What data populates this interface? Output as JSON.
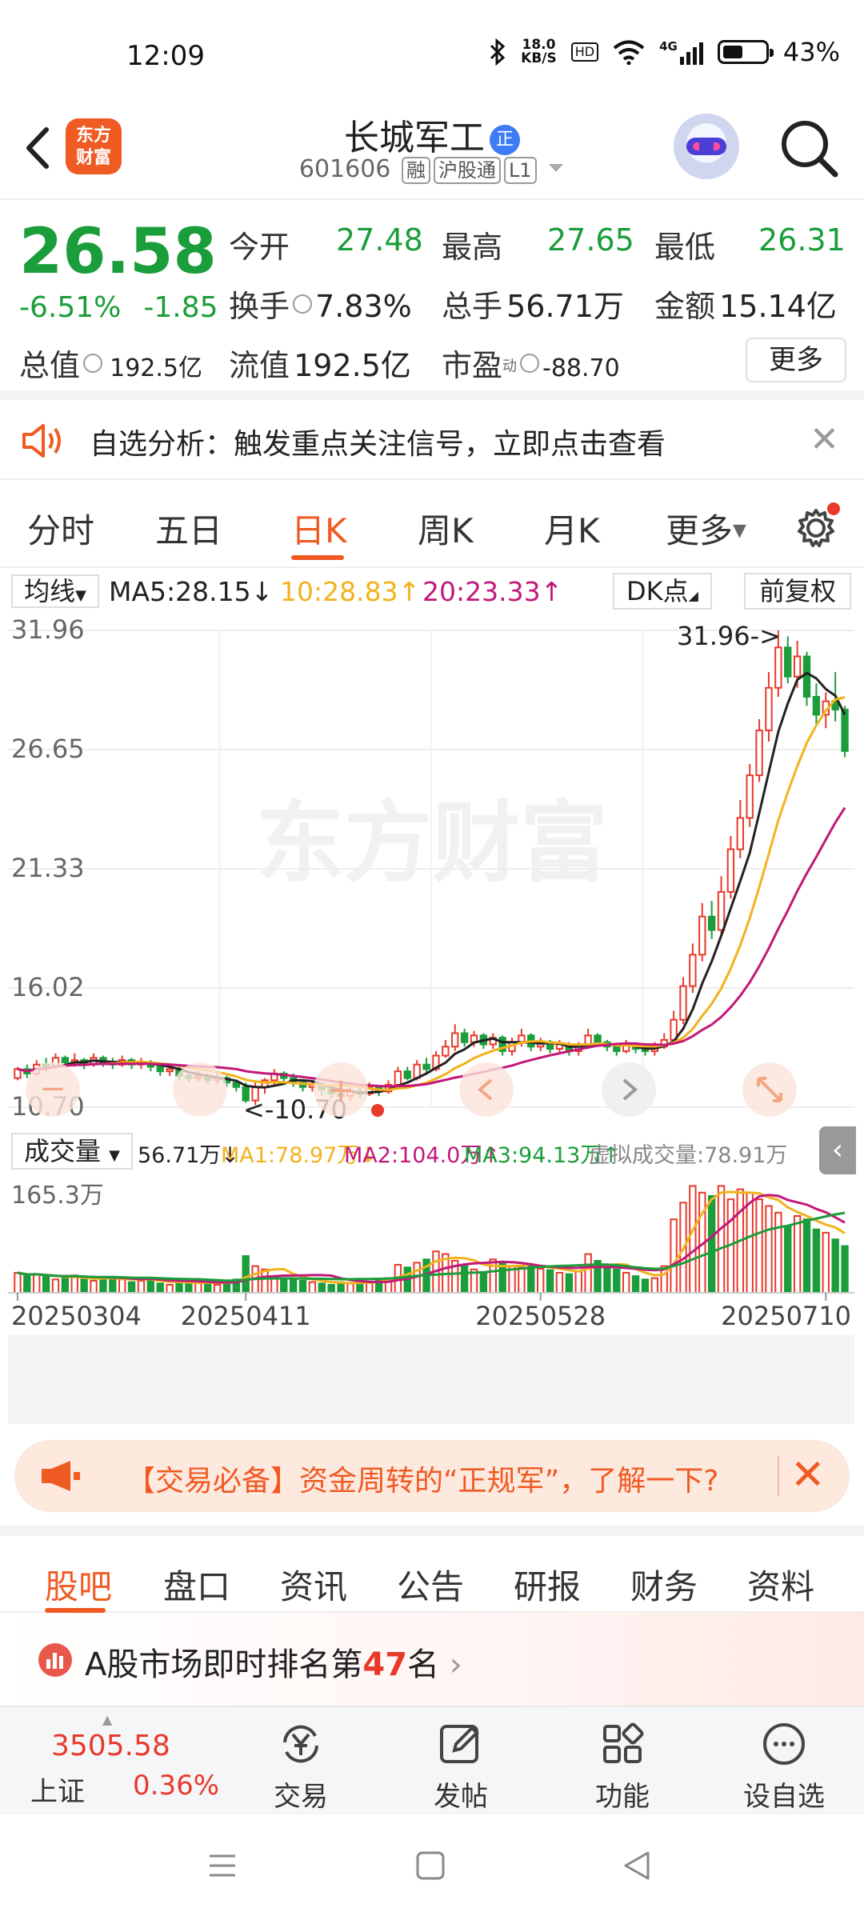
{
  "status": {
    "time": "12:09",
    "net_speed_top": "18.0",
    "net_speed_bottom": "KB/S",
    "hd": "HD",
    "signal": "4G",
    "battery": "43%"
  },
  "header": {
    "logo_line1": "东方",
    "logo_line2": "财富",
    "stock_name": "长城军工",
    "stock_badge": "正",
    "stock_code": "601606",
    "tags": [
      "融",
      "沪股通",
      "L1"
    ]
  },
  "quote": {
    "price": "26.58",
    "change_pct": "-6.51%",
    "change_abs": "-1.85",
    "open_label": "今开",
    "open": "27.48",
    "high_label": "最高",
    "high": "27.65",
    "low_label": "最低",
    "low": "26.31",
    "turnover_label": "换手",
    "turnover": "7.83%",
    "volume_label": "总手",
    "volume": "56.71万",
    "amount_label": "金额",
    "amount": "15.14亿",
    "mktcap_label": "总值",
    "mktcap": "192.5亿",
    "float_label": "流值",
    "float_cap": "192.5亿",
    "pe_label": "市盈",
    "pe_sup": "动",
    "pe": "-88.70",
    "more": "更多"
  },
  "alert": {
    "text": "自选分析：触发重点关注信号，立即点击查看"
  },
  "chart_tabs": [
    "分时",
    "五日",
    "日K",
    "周K",
    "月K",
    "更多"
  ],
  "indicator": {
    "select": "均线",
    "ma5": "MA5:28.15",
    "ma10": "10:28.83",
    "ma20": "20:23.33",
    "dk": "DK点",
    "adjust": "前复权"
  },
  "colors": {
    "up": "#e8392b",
    "down": "#1a9d3a",
    "ma5": "#222222",
    "ma10": "#f2b21c",
    "ma20": "#c2187a",
    "accent": "#f05a23"
  },
  "watermark": "东方财富",
  "kline_labels": {
    "high_marker": "31.96->",
    "low_marker": "<-10.70"
  },
  "volume": {
    "select": "成交量",
    "vol": "56.71万",
    "ma1": "MA1:78.97万",
    "ma2": "MA2:104.0万",
    "ma3": "MA3:94.13万",
    "virtual": "虚拟成交量:78.91万",
    "max_label": "165.3万"
  },
  "chart_data": {
    "type": "candlestick",
    "y_ticks": [
      "31.96",
      "26.65",
      "21.33",
      "16.02",
      "10.70"
    ],
    "ylim": [
      10.7,
      31.96
    ],
    "x_ticks": [
      "20250304",
      "20250411",
      "20250528",
      "20250710"
    ],
    "highest": 31.96,
    "lowest": 10.7,
    "series": [
      {
        "name": "MA5",
        "last": 28.15
      },
      {
        "name": "MA10",
        "last": 28.83
      },
      {
        "name": "MA20",
        "last": 23.33
      }
    ],
    "candles": [
      [
        12.0,
        12.4,
        11.9,
        12.5
      ],
      [
        12.4,
        12.2,
        12.0,
        12.6
      ],
      [
        12.2,
        12.6,
        12.1,
        12.8
      ],
      [
        12.6,
        12.5,
        12.3,
        12.9
      ],
      [
        12.5,
        12.9,
        12.4,
        13.1
      ],
      [
        12.9,
        12.7,
        12.5,
        13.0
      ],
      [
        12.7,
        12.8,
        12.5,
        13.1
      ],
      [
        12.8,
        12.6,
        12.4,
        12.9
      ],
      [
        12.6,
        12.9,
        12.5,
        13.1
      ],
      [
        12.9,
        12.7,
        12.5,
        13.0
      ],
      [
        12.7,
        12.6,
        12.4,
        12.9
      ],
      [
        12.6,
        12.8,
        12.5,
        13.0
      ],
      [
        12.8,
        12.6,
        12.4,
        12.9
      ],
      [
        12.6,
        12.7,
        12.4,
        12.9
      ],
      [
        12.7,
        12.5,
        12.3,
        12.8
      ],
      [
        12.5,
        12.3,
        12.1,
        12.6
      ],
      [
        12.3,
        12.4,
        12.1,
        12.6
      ],
      [
        12.4,
        12.1,
        11.9,
        12.5
      ],
      [
        12.1,
        12.0,
        11.8,
        12.3
      ],
      [
        12.0,
        12.1,
        11.8,
        12.3
      ],
      [
        12.1,
        11.9,
        11.7,
        12.2
      ],
      [
        11.9,
        12.0,
        11.7,
        12.2
      ],
      [
        12.0,
        11.8,
        11.6,
        12.1
      ],
      [
        11.8,
        11.6,
        11.4,
        11.9
      ],
      [
        11.6,
        11.0,
        10.9,
        11.8
      ],
      [
        11.0,
        11.6,
        10.8,
        11.8
      ],
      [
        11.6,
        11.9,
        11.3,
        12.0
      ],
      [
        11.9,
        12.2,
        11.7,
        12.4
      ],
      [
        12.2,
        12.0,
        11.8,
        12.3
      ],
      [
        12.0,
        11.8,
        11.6,
        12.2
      ],
      [
        11.8,
        11.6,
        11.4,
        11.9
      ],
      [
        11.6,
        11.7,
        11.4,
        11.9
      ],
      [
        11.7,
        11.5,
        11.2,
        11.8
      ],
      [
        11.5,
        11.3,
        11.1,
        11.7
      ],
      [
        11.3,
        11.2,
        10.9,
        11.5
      ],
      [
        11.2,
        11.4,
        11.0,
        11.6
      ],
      [
        11.4,
        11.3,
        11.1,
        11.6
      ],
      [
        11.3,
        11.6,
        11.2,
        11.8
      ],
      [
        11.6,
        11.4,
        11.2,
        11.7
      ],
      [
        11.4,
        11.7,
        11.3,
        11.9
      ],
      [
        11.7,
        12.3,
        11.6,
        12.5
      ],
      [
        12.3,
        12.0,
        11.9,
        12.5
      ],
      [
        12.0,
        12.6,
        11.9,
        12.8
      ],
      [
        12.6,
        12.4,
        12.2,
        12.9
      ],
      [
        12.4,
        13.0,
        12.3,
        13.2
      ],
      [
        13.0,
        13.4,
        12.9,
        13.7
      ],
      [
        13.4,
        14.0,
        13.2,
        14.4
      ],
      [
        14.0,
        13.6,
        13.4,
        14.2
      ],
      [
        13.6,
        13.9,
        13.4,
        14.1
      ],
      [
        13.9,
        13.5,
        13.3,
        14.0
      ],
      [
        13.5,
        13.8,
        13.3,
        14.0
      ],
      [
        13.8,
        13.2,
        13.0,
        13.9
      ],
      [
        13.2,
        13.6,
        13.0,
        13.8
      ],
      [
        13.6,
        13.9,
        13.4,
        14.2
      ],
      [
        13.9,
        13.4,
        13.2,
        14.0
      ],
      [
        13.4,
        13.6,
        13.2,
        13.8
      ],
      [
        13.6,
        13.3,
        13.1,
        13.7
      ],
      [
        13.3,
        13.5,
        13.1,
        13.7
      ],
      [
        13.5,
        13.2,
        13.0,
        13.6
      ],
      [
        13.2,
        13.4,
        13.0,
        13.6
      ],
      [
        13.4,
        13.9,
        13.3,
        14.2
      ],
      [
        13.9,
        13.6,
        13.4,
        14.0
      ],
      [
        13.6,
        13.4,
        13.2,
        13.7
      ],
      [
        13.4,
        13.2,
        13.0,
        13.5
      ],
      [
        13.2,
        13.5,
        13.1,
        13.7
      ],
      [
        13.5,
        13.3,
        13.1,
        13.6
      ],
      [
        13.3,
        13.2,
        13.0,
        13.5
      ],
      [
        13.2,
        13.4,
        13.0,
        13.6
      ],
      [
        13.4,
        13.7,
        13.3,
        14.0
      ],
      [
        13.7,
        14.6,
        13.6,
        15.0
      ],
      [
        14.6,
        16.1,
        14.4,
        16.5
      ],
      [
        16.1,
        17.5,
        15.8,
        18.0
      ],
      [
        17.5,
        19.2,
        17.2,
        19.8
      ],
      [
        19.2,
        18.6,
        18.2,
        19.9
      ],
      [
        18.6,
        20.3,
        18.4,
        21.0
      ],
      [
        20.3,
        22.2,
        20.0,
        22.8
      ],
      [
        22.2,
        23.6,
        21.8,
        24.4
      ],
      [
        23.6,
        25.5,
        23.2,
        26.0
      ],
      [
        25.5,
        27.5,
        25.2,
        28.0
      ],
      [
        27.5,
        29.4,
        27.0,
        30.1
      ],
      [
        29.4,
        31.2,
        29.0,
        31.96
      ],
      [
        31.2,
        29.9,
        29.6,
        31.7
      ],
      [
        29.9,
        30.8,
        29.4,
        31.5
      ],
      [
        30.8,
        29.0,
        28.6,
        31.0
      ],
      [
        29.0,
        28.2,
        27.8,
        29.6
      ],
      [
        28.2,
        28.8,
        27.6,
        29.2
      ],
      [
        28.8,
        28.43,
        27.9,
        30.1
      ],
      [
        28.43,
        26.58,
        26.31,
        28.6
      ]
    ],
    "volumes": [
      30,
      25,
      28,
      24,
      20,
      22,
      26,
      20,
      18,
      22,
      24,
      20,
      16,
      18,
      22,
      14,
      12,
      15,
      14,
      18,
      16,
      12,
      14,
      20,
      55,
      40,
      35,
      25,
      22,
      20,
      18,
      16,
      14,
      12,
      16,
      14,
      18,
      15,
      20,
      22,
      42,
      38,
      45,
      50,
      62,
      58,
      48,
      40,
      35,
      30,
      50,
      45,
      40,
      38,
      42,
      36,
      34,
      30,
      28,
      32,
      58,
      48,
      40,
      35,
      30,
      25,
      20,
      22,
      40,
      110,
      135,
      160,
      150,
      145,
      160,
      140,
      155,
      150,
      140,
      130,
      120,
      100,
      115,
      110,
      95,
      90,
      80,
      70
    ],
    "volume_max": 165.3
  },
  "promo": {
    "text": "【交易必备】资金周转的“正规军”，了解一下?"
  },
  "sub_tabs": [
    "股吧",
    "盘口",
    "资讯",
    "公告",
    "研报",
    "财务",
    "资料"
  ],
  "rank": {
    "prefix": "A股市场即时排名第",
    "num": "47",
    "suffix": "名"
  },
  "bottom_bar": {
    "index_value": "3505.58",
    "index_name": "上证",
    "index_pct": "0.36%",
    "trade": "交易",
    "post": "发帖",
    "func": "功能",
    "watch": "设自选"
  }
}
